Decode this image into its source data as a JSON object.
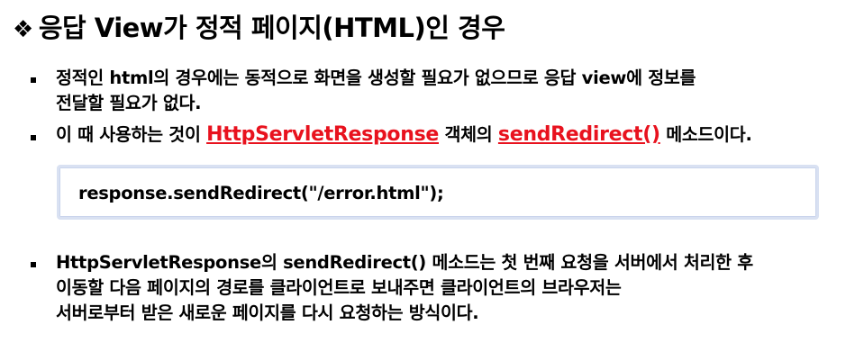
{
  "title": {
    "marker": "❖",
    "text": "응답 View가 정적 페이지(HTML)인 경우"
  },
  "bullets": [
    {
      "line1": "정적인 html의 경우에는 동적으로 화면을 생성할 필요가 없으므로 응답 view에 정보를",
      "line2": "전달할 필요가 없다."
    },
    {
      "pre": "이 때 사용하는 것이 ",
      "highlight1": "HttpServletResponse",
      "mid": " 객체의 ",
      "highlight2": "sendRedirect()",
      "post": " 메소드이다."
    },
    {
      "line1": "HttpServletResponse의 sendRedirect() 메소드는 첫 번째 요청을 서버에서 처리한 후",
      "line2": "이동할 다음 페이지의 경로를 클라이언트로 보내주면 클라이언트의 브라우저는",
      "line3": "서버로부터 받은 새로운 페이지를 다시 요청하는 방식이다."
    }
  ],
  "code": "response.sendRedirect(\"/error.html\");",
  "colors": {
    "highlight": "#e8121e",
    "code_box_border": "#d9e1f2"
  }
}
